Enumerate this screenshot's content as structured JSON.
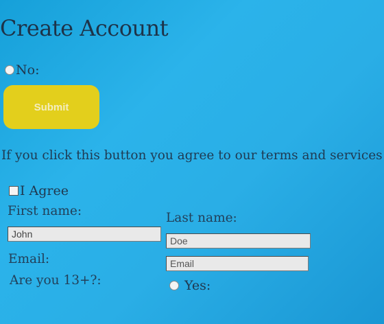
{
  "form": {
    "title": "Create Account",
    "radio_no_label": "No:",
    "submit_label": "Submit",
    "notice": "If you click this button you agree to our terms and services",
    "agree_label": "I Agree",
    "first_name_label": "First name:",
    "first_name_value": "John",
    "last_name_label": "Last name:",
    "last_name_placeholder": "Doe",
    "email_label": "Email:",
    "email_placeholder": "Email",
    "age_question": "Are you 13+?:",
    "radio_yes_label": "Yes:"
  },
  "colors": {
    "background": "#2aaee6",
    "submit_button": "#e3cf1c",
    "text": "#1f3a52"
  }
}
